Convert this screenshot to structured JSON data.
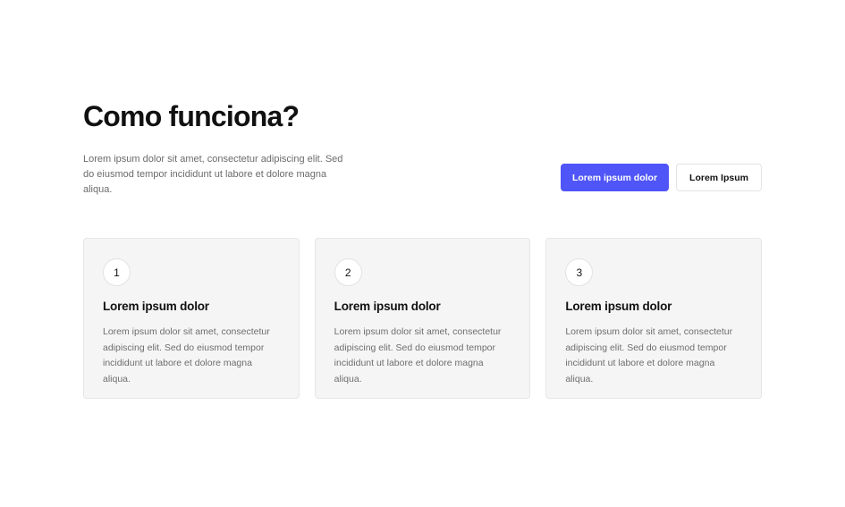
{
  "section": {
    "title": "Como funciona?",
    "intro": "Lorem ipsum dolor sit amet, consectetur adipiscing elit. Sed do eiusmod tempor incididunt ut labore et dolore magna aliqua."
  },
  "actions": {
    "primary_label": "Lorem ipsum dolor",
    "secondary_label": "Lorem Ipsum"
  },
  "cards": [
    {
      "number": "1",
      "title": "Lorem ipsum dolor",
      "text": "Lorem ipsum dolor sit amet, consectetur adipiscing elit. Sed do eiusmod tempor incididunt ut labore et dolore magna aliqua."
    },
    {
      "number": "2",
      "title": "Lorem ipsum dolor",
      "text": "Lorem ipsum dolor sit amet, consectetur adipiscing elit. Sed do eiusmod tempor incididunt ut labore et dolore magna aliqua."
    },
    {
      "number": "3",
      "title": "Lorem ipsum dolor",
      "text": "Lorem ipsum dolor sit amet, consectetur adipiscing elit. Sed do eiusmod tempor incididunt ut labore et dolore magna aliqua."
    }
  ],
  "colors": {
    "accent": "#4f55f7",
    "card_background": "#f5f5f5",
    "text_muted": "#6e6e6e"
  }
}
